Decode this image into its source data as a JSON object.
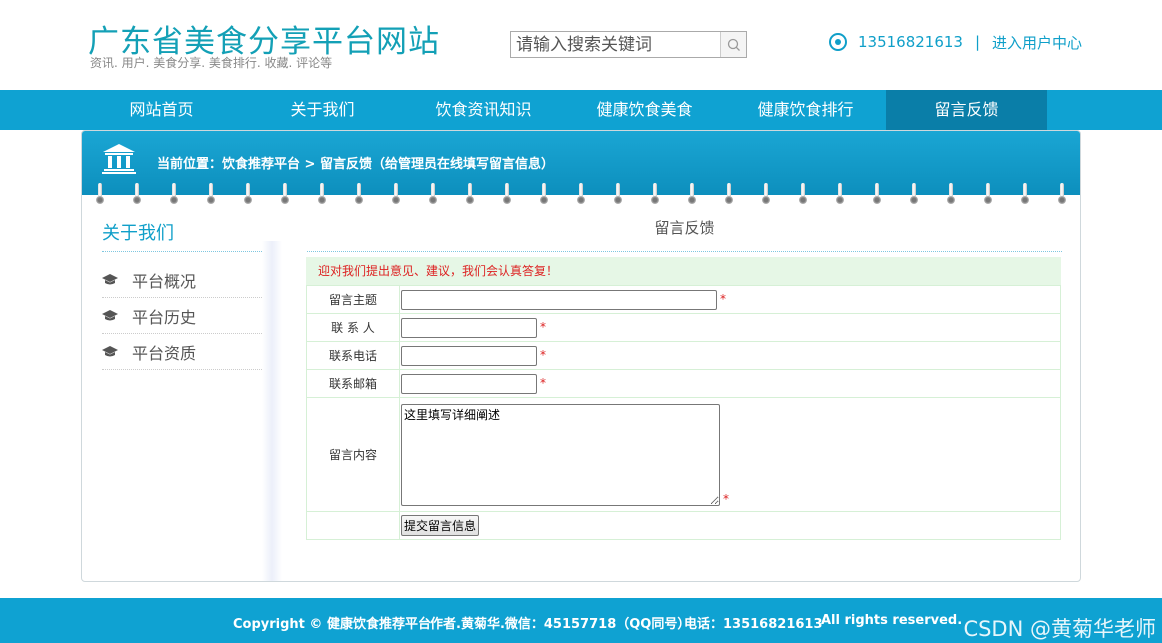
{
  "header": {
    "site_title": "广东省美食分享平台网站",
    "site_subtitle": "资讯. 用户. 美食分享. 美食排行. 收藏. 评论等",
    "search_placeholder": "请输入搜索关键词",
    "phone": "13516821613",
    "separator": "|",
    "user_center_link": "进入用户中心"
  },
  "nav": {
    "items": [
      {
        "label": "网站首页"
      },
      {
        "label": "关于我们"
      },
      {
        "label": "饮食资讯知识"
      },
      {
        "label": "健康饮食美食"
      },
      {
        "label": "健康饮食排行"
      },
      {
        "label": "留言反馈"
      }
    ],
    "active_index": 5
  },
  "breadcrumb": "当前位置：饮食推荐平台 > 留言反馈（给管理员在线填写留言信息）",
  "sidebar": {
    "title": "关于我们",
    "items": [
      {
        "label": "平台概况"
      },
      {
        "label": "平台历史"
      },
      {
        "label": "平台资质"
      }
    ]
  },
  "form": {
    "title": "留言反馈",
    "notice": "迎对我们提出意见、建议，我们会认真答复！",
    "fields": {
      "subject_label": "留言主题",
      "contact_label": "联 系 人",
      "phone_label": "联系电话",
      "email_label": "联系邮箱",
      "content_label": "留言内容",
      "subject_value": "",
      "contact_value": "",
      "phone_value": "",
      "email_value": "",
      "content_value": "这里填写详细阐述"
    },
    "required_mark": "*",
    "submit_label": "提交留言信息"
  },
  "footer": {
    "copyright": "Copyright © 健康饮食推荐平台",
    "author": "作者.黄菊华.微信：45157718（QQ同号）",
    "phone": "电话：13516821613",
    "rights": "All rights reserved.",
    "watermark": "CSDN @黄菊华老师"
  },
  "colors": {
    "brand": "#13a0b6",
    "nav_bg": "#0fa2d2",
    "nav_active": "#0a7ea8",
    "link": "#0f9fc9",
    "required": "#dd2222",
    "notice_bg": "#e6f7e6"
  },
  "icons": {
    "search": "search-icon",
    "phone": "target-circle-icon",
    "breadcrumb": "bank-building-icon",
    "sidebar": "graduation-cap-icon"
  }
}
